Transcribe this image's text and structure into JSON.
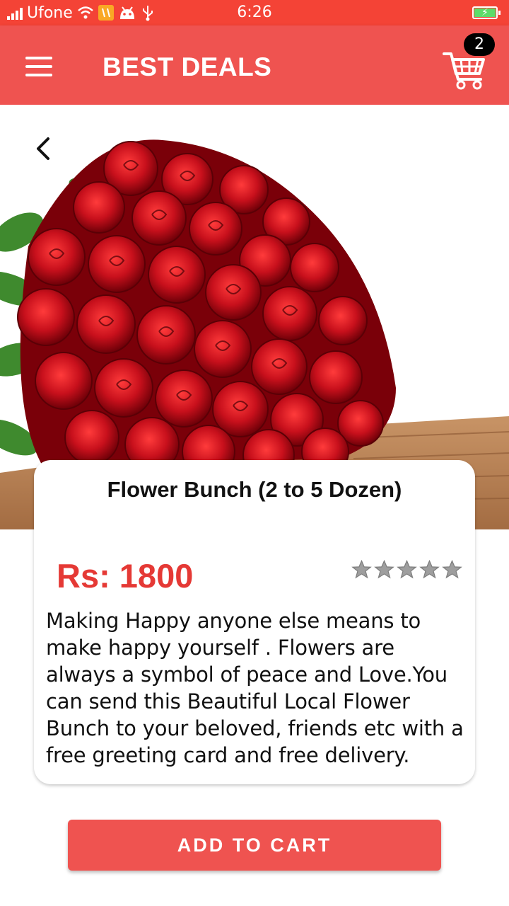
{
  "status_bar": {
    "carrier": "Ufone",
    "time": "6:26"
  },
  "app_bar": {
    "title": "BEST DEALS",
    "cart_count": "2"
  },
  "product": {
    "name": "Flower Bunch (2 to 5 Dozen)",
    "price": "Rs: 1800",
    "rating": 0,
    "rating_max": 5,
    "description": "Making Happy anyone else means to make happy yourself . Flowers are always a symbol of peace and Love.You can send this Beautiful Local Flower Bunch to your beloved, friends etc with a free greeting card and free delivery."
  },
  "actions": {
    "add_to_cart": "ADD TO CART"
  },
  "colors": {
    "status_bar": "#f44336",
    "app_bar": "#ef5350",
    "price": "#e53935",
    "star": "#9e9e9e"
  }
}
